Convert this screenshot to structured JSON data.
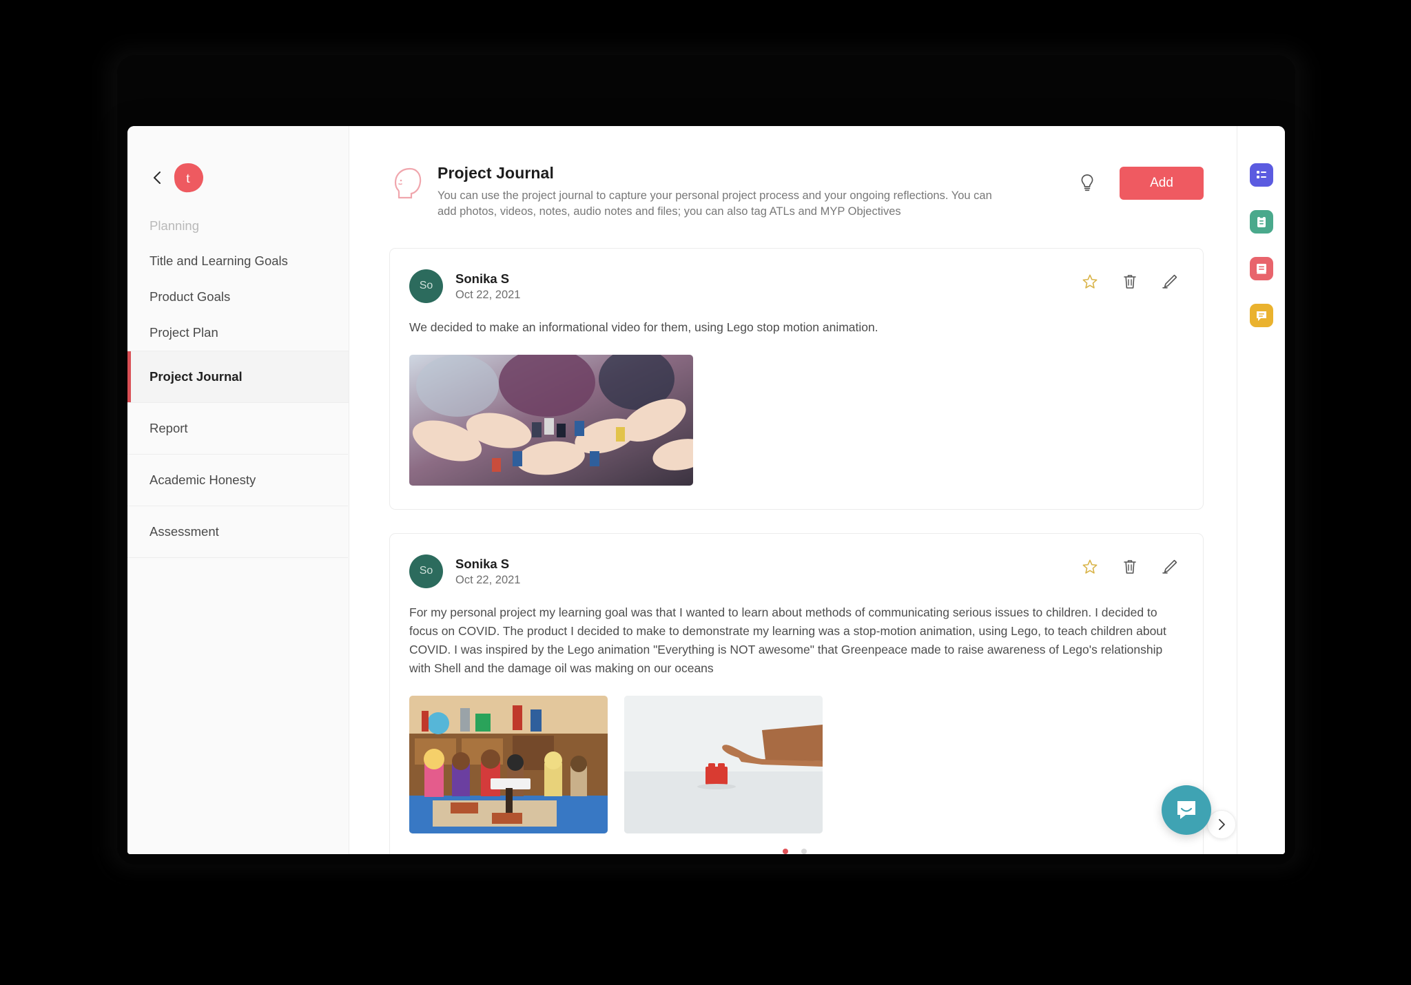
{
  "sidebar": {
    "back_icon": "chevron-left-icon",
    "logo_letter": "t",
    "section_heading": "Planning",
    "items": [
      {
        "label": "Title and Learning Goals",
        "active": false
      },
      {
        "label": "Product Goals",
        "active": false
      },
      {
        "label": "Project Plan",
        "active": false
      },
      {
        "label": "Project Journal",
        "active": true
      },
      {
        "label": "Report",
        "active": false
      },
      {
        "label": "Academic Honesty",
        "active": false
      },
      {
        "label": "Assessment",
        "active": false
      }
    ]
  },
  "header": {
    "icon": "head-profile-icon",
    "title": "Project Journal",
    "description": "You can use the project journal to capture your personal project process and your ongoing reflections. You can add photos, videos, notes, audio notes and files; you can also tag ATLs and MYP Objectives",
    "hint_icon": "lightbulb-icon",
    "add_label": "Add",
    "add_color": "#ef5a61"
  },
  "entries": [
    {
      "avatar_initials": "So",
      "author": "Sonika S",
      "date": "Oct 22, 2021",
      "text": "We decided to make an informational video for them, using Lego stop motion animation.",
      "actions": [
        "star-icon",
        "trash-icon",
        "edit-pencil-icon"
      ],
      "media_count": 1,
      "dots": null
    },
    {
      "avatar_initials": "So",
      "author": "Sonika S",
      "date": "Oct 22, 2021",
      "text": "For my personal project my learning goal was that I wanted to learn about methods of communicating serious issues to children. I decided to focus on COVID. The product I decided to make to demonstrate my learning was a stop-motion animation, using Lego, to teach children about COVID. I was inspired by the Lego animation \"Everything is NOT awesome\" that Greenpeace made to raise awareness of Lego's relationship with Shell and the damage oil was making on our oceans",
      "actions": [
        "star-icon",
        "trash-icon",
        "edit-pencil-icon"
      ],
      "media_count": 2,
      "dots": {
        "total": 2,
        "active": 0
      },
      "next_icon": "chevron-right-icon"
    }
  ],
  "rail": {
    "items": [
      {
        "name": "list-panel-icon",
        "color": "#5b5be0"
      },
      {
        "name": "clipboard-panel-icon",
        "color": "#4aa98c"
      },
      {
        "name": "book-panel-icon",
        "color": "#e8646c"
      },
      {
        "name": "chat-panel-icon",
        "color": "#eab22e"
      }
    ]
  },
  "chat": {
    "icon": "intercom-chat-icon",
    "color": "#3fa3b3"
  },
  "colors": {
    "accent": "#ef5a61",
    "avatar": "#2c6b5d",
    "star": "#d9b44a",
    "active_dot": "#e05258"
  }
}
